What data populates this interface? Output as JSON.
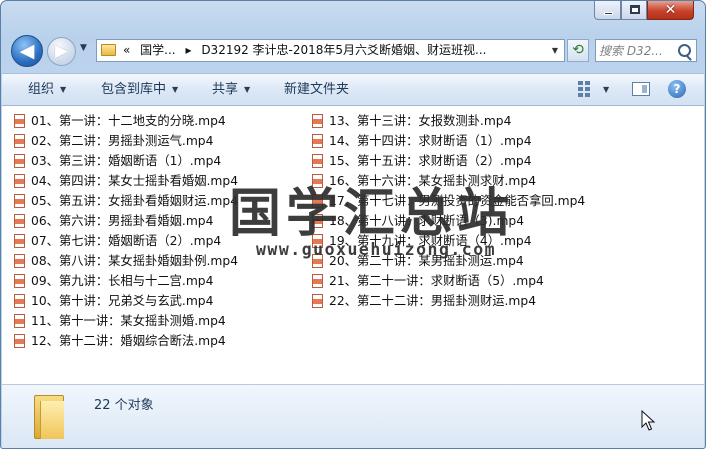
{
  "window": {
    "close_glyph": "✕"
  },
  "nav": {
    "back_glyph": "◀",
    "forward_glyph": "▶",
    "recent_glyph": "▼"
  },
  "address": {
    "chevron": "«",
    "parts": [
      "国学...",
      "▸",
      "D32192 李计忠-2018年5月六爻断婚姻、财运班视..."
    ],
    "dropdown_glyph": "▼",
    "refresh_glyph": "⟲"
  },
  "search": {
    "placeholder": "搜索 D32..."
  },
  "toolbar": {
    "organize": "组织",
    "include_in_library": "包含到库中",
    "share": "共享",
    "new_folder": "新建文件夹",
    "caret": "▼",
    "help_glyph": "?"
  },
  "files": [
    "01、第一讲：十二地支的分晓.mp4",
    "02、第二讲：男摇卦测运气.mp4",
    "03、第三讲：婚姻断语（1）.mp4",
    "04、第四讲：某女士摇卦看婚姻.mp4",
    "05、第五讲：女摇卦看婚姻财运.mp4",
    "06、第六讲：男摇卦看婚姻.mp4",
    "07、第七讲：婚姻断语（2）.mp4",
    "08、第八讲：某女摇卦婚姻卦例.mp4",
    "09、第九讲：长相与十二宫.mp4",
    "10、第十讲：兄弟爻与玄武.mp4",
    "11、第十一讲：某女摇卦测婚.mp4",
    "12、第十二讲：婚姻综合断法.mp4",
    "13、第十三讲：女报数测卦.mp4",
    "14、第十四讲：求财断语（1）.mp4",
    "15、第十五讲：求财断语（2）.mp4",
    "16、第十六讲：某女摇卦测求财.mp4",
    "17、第十七讲：男测投资的资金能否拿回.mp4",
    "18、第十八讲：求财断语（3).mp4",
    "19、第十九讲：求财断语（4）.mp4",
    "20、第二十讲：某男摇卦测运.mp4",
    "21、第二十一讲：求财断语（5）.mp4",
    "22、第二十二讲：男摇卦测财运.mp4"
  ],
  "watermark": {
    "title": "国学汇总站",
    "url": "www.guoxuehuizong.com"
  },
  "details": {
    "count": "22 个对象"
  }
}
